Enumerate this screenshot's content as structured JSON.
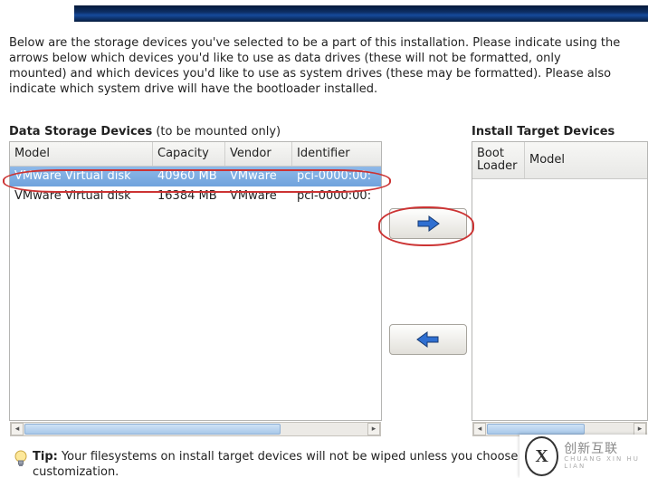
{
  "instructions": "Below are the storage devices you've selected to be a part of this installation.  Please indicate using the arrows below which devices you'd like to use as data drives (these will not be formatted, only mounted) and which devices you'd like to use as system drives (these may be formatted).  Please also indicate which system drive will have the bootloader installed.",
  "sections": {
    "data_storage_title": "Data Storage Devices",
    "data_storage_sub": " (to be mounted only)",
    "install_target_title": "Install Target Devices"
  },
  "left_table": {
    "headers": {
      "model": "Model",
      "capacity": "Capacity",
      "vendor": "Vendor",
      "identifier": "Identifier"
    },
    "rows": [
      {
        "model": "VMware Virtual disk",
        "capacity": "40960 MB",
        "vendor": "VMware",
        "identifier": "pci-0000:00:",
        "selected": true
      },
      {
        "model": "VMware Virtual disk",
        "capacity": "16384 MB",
        "vendor": "VMware",
        "identifier": "pci-0000:00:",
        "selected": false
      }
    ]
  },
  "right_table": {
    "headers": {
      "boot_loader": "Boot\nLoader",
      "model": "Model"
    },
    "rows": []
  },
  "buttons": {
    "move_right_name": "move-right-button",
    "move_left_name": "move-left-button"
  },
  "tip": {
    "label": "Tip:",
    "text": " Your filesystems on install target devices will not be wiped unless you choose to do so during customization."
  },
  "watermark": {
    "logo": "Ⓧ",
    "text_top": "创新互联",
    "text_bottom": "CHUANG XIN HU LIAN"
  },
  "colors": {
    "arrow_blue": "#2f6fd1",
    "arrow_shadow": "#173a72"
  }
}
